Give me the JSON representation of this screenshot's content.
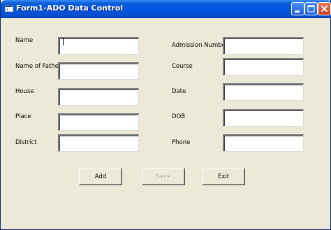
{
  "window": {
    "title": "Form1-ADO Data Control",
    "app_icon": "vb-form-icon",
    "controls": {
      "minimize": "minimize-icon",
      "maximize": "maximize-icon",
      "close": "close-icon"
    }
  },
  "form": {
    "left_fields": [
      {
        "label": "Name",
        "value": ""
      },
      {
        "label": "Name of Father",
        "value": ""
      },
      {
        "label": "House",
        "value": ""
      },
      {
        "label": "Place",
        "value": ""
      },
      {
        "label": "District",
        "value": ""
      }
    ],
    "right_fields": [
      {
        "label": "Admission Number",
        "value": ""
      },
      {
        "label": "Course",
        "value": ""
      },
      {
        "label": "Date",
        "value": ""
      },
      {
        "label": "DOB",
        "value": ""
      },
      {
        "label": "Phone",
        "value": ""
      }
    ]
  },
  "buttons": {
    "add": "Add",
    "save": "Save",
    "exit": "Exit",
    "save_disabled": true
  },
  "colors": {
    "titlebar": "#0054e3",
    "face": "#ece9d8",
    "disabled_text": "#aca899"
  }
}
